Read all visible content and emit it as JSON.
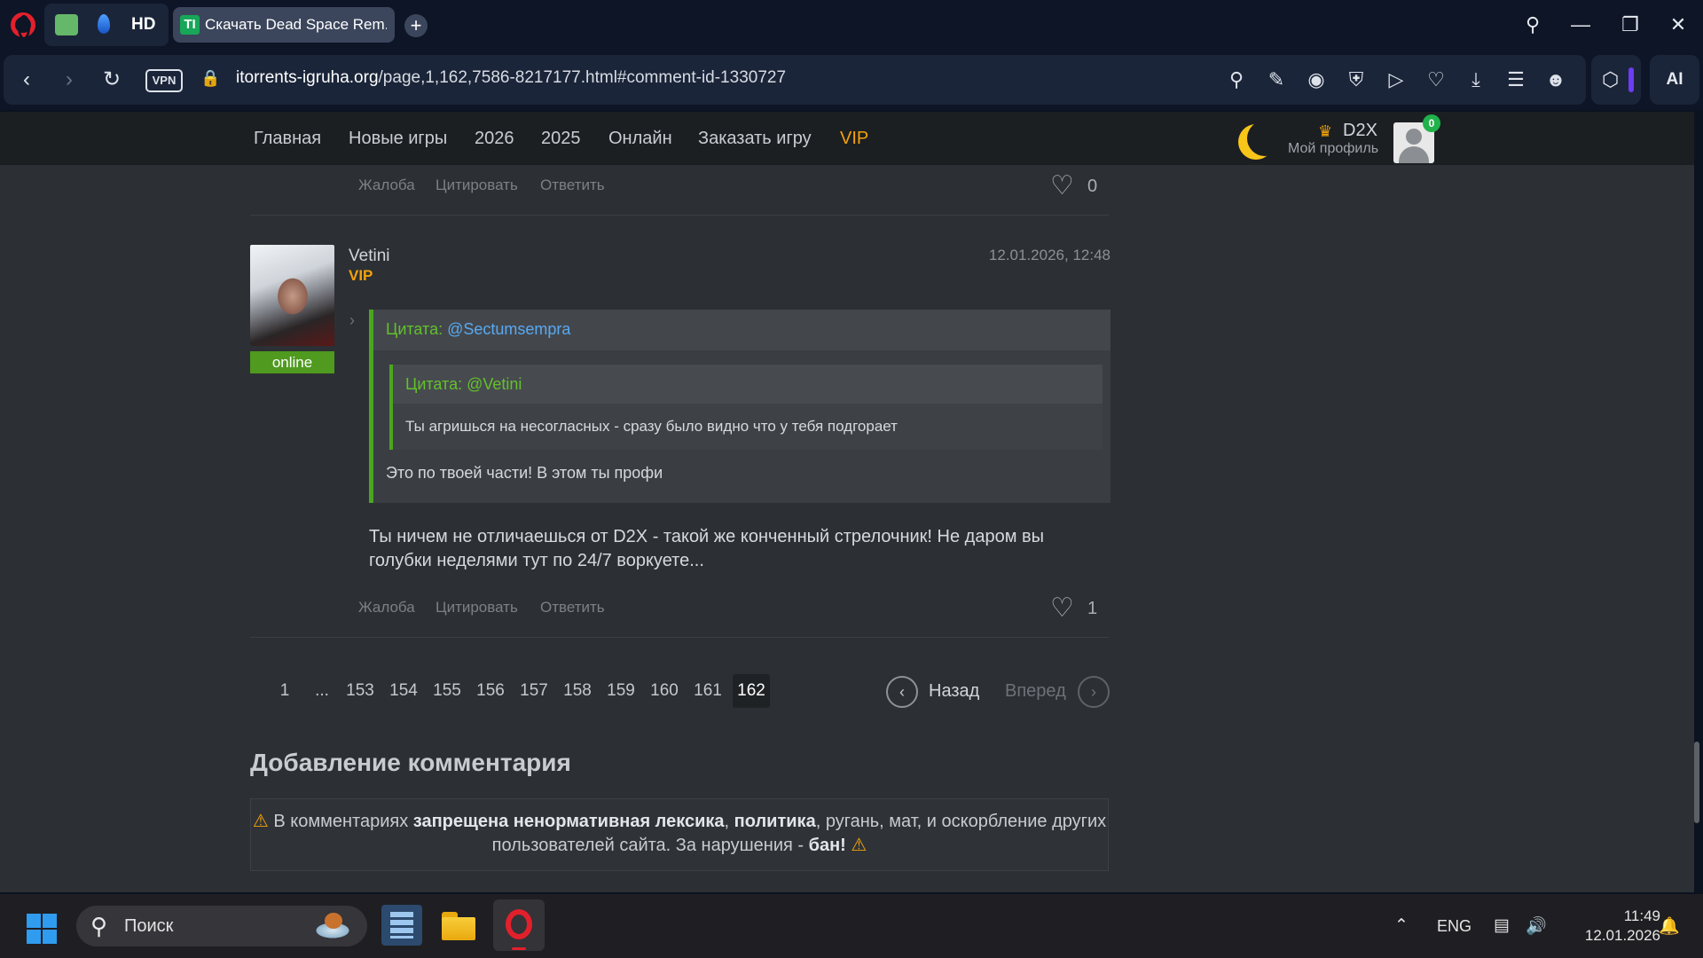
{
  "browser": {
    "tab_group": {
      "hd_label": "HD"
    },
    "active_tab": {
      "favicon_text": "TI",
      "title": "Скачать Dead Space Rem..."
    },
    "new_tab_symbol": "+",
    "vpn_label": "VPN",
    "url_domain": "itorrents-igruha.org",
    "url_path": "/page,1,162,7586-8217177.html#comment-id-1330727",
    "ai_label": "AI",
    "accent_color": "#6c3df4"
  },
  "site_header": {
    "nav": [
      "Главная",
      "Новые игры",
      "2026",
      "2025",
      "Онлайн",
      "Заказать игру",
      "VIP"
    ],
    "vip_color": "#f2a20c",
    "user_name": "D2X",
    "profile_link": "Мой профиль",
    "notifications_count": "0"
  },
  "prev_comment": {
    "actions": [
      "Жалоба",
      "Цитировать",
      "Ответить"
    ],
    "likes": "0"
  },
  "comment": {
    "author": "Vetini",
    "role": "VIP",
    "status": "online",
    "date": "12.01.2026, 12:48",
    "quote_outer": {
      "label": "Цитата:",
      "mention": "@Sectumsempra",
      "reply_text": "Это по твоей части! В этом ты профи",
      "quote_inner": {
        "label": "Цитата:",
        "mention": "@Vetini",
        "text": "Ты агришься на несогласных - сразу было видно что у тебя подгорает"
      }
    },
    "body": "Ты ничем не отличаешься от D2X - такой же конченный стрелочник! Не даром вы голубки неделями тут по 24/7 воркуете...",
    "actions": [
      "Жалоба",
      "Цитировать",
      "Ответить"
    ],
    "likes": "1"
  },
  "pagination": {
    "pages": [
      "1",
      "...",
      "153",
      "154",
      "155",
      "156",
      "157",
      "158",
      "159",
      "160",
      "161",
      "162"
    ],
    "current": "162",
    "prev_label": "Назад",
    "next_label": "Вперед"
  },
  "add_comment": {
    "title": "Добавление комментария",
    "warning_prefix": "В комментариях",
    "warning_bold1": "запрещена ненормативная лексика",
    "warning_sep": ",",
    "warning_bold2": "политика",
    "warning_rest": ", ругань, мат, и оскорбление других пользователей сайта. За нарушения -",
    "warning_bold3": "бан!"
  },
  "taskbar": {
    "search_placeholder": "Поиск",
    "language": "ENG",
    "time": "11:49",
    "date": "12.01.2026"
  },
  "icons": {
    "browser_logo": "opera-icon",
    "back": "arrow-left-icon",
    "forward": "arrow-right-icon",
    "reload": "reload-icon",
    "like": "heart-icon",
    "theme": "moon-icon",
    "start": "windows-icon"
  }
}
